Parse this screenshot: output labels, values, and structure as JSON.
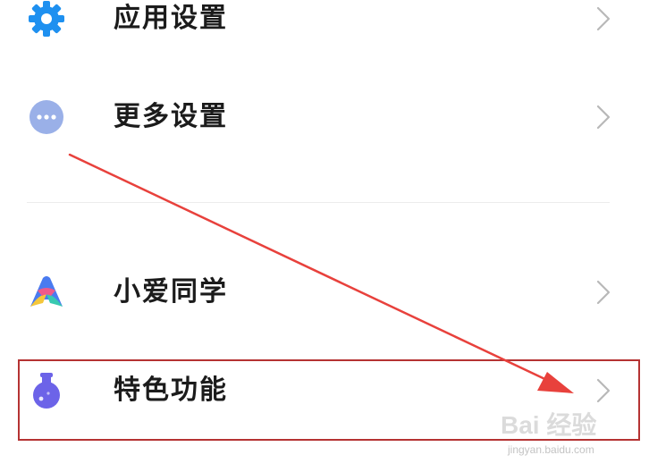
{
  "settings_list": {
    "items": [
      {
        "label": "应用设置",
        "icon": "gear-icon",
        "icon_color": "#1e90f0"
      },
      {
        "label": "更多设置",
        "icon": "more-dots-icon",
        "icon_color": "#9ab0e8"
      },
      {
        "label": "小爱同学",
        "icon": "xiaoai-icon",
        "icon_color": "#4a7bf0"
      },
      {
        "label": "特色功能",
        "icon": "flask-icon",
        "icon_color": "#6c63e8"
      }
    ]
  },
  "annotation": {
    "highlight_color": "#b53333",
    "arrow_color": "#e8413c"
  },
  "watermark": {
    "brand": "Bai 经验",
    "url": "jingyan.baidu.com"
  }
}
